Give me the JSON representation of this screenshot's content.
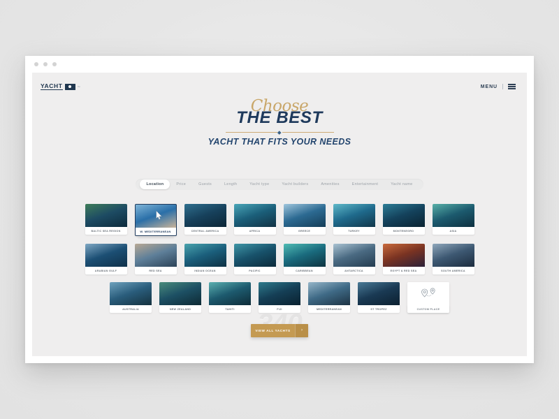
{
  "browser": {
    "dots": 3
  },
  "header": {
    "logo_word": "YACHT",
    "logo_tm": "™",
    "menu_label": "MENU"
  },
  "hero": {
    "script_word": "Choose",
    "main_line": "THE BEST",
    "sub_line": "YACHT THAT FITS YOUR NEEDS"
  },
  "filters": {
    "items": [
      {
        "label": "Location",
        "active": true
      },
      {
        "label": "Price",
        "active": false
      },
      {
        "label": "Guests",
        "active": false
      },
      {
        "label": "Length",
        "active": false
      },
      {
        "label": "Yacht type",
        "active": false
      },
      {
        "label": "Yacht builders",
        "active": false
      },
      {
        "label": "Amenities",
        "active": false
      },
      {
        "label": "Entertainment",
        "active": false
      },
      {
        "label": "Yacht name",
        "active": false
      }
    ]
  },
  "destinations": {
    "row1": [
      {
        "label": "BALTIC SEA REGION",
        "c1": "#1d4b63",
        "c2": "#3f7d5a",
        "c3": "#0d2b3c"
      },
      {
        "label": "W. MEDITERRANEAN",
        "c1": "#2a6fa8",
        "c2": "#7fb5d8",
        "c3": "#c9b49a",
        "active": true
      },
      {
        "label": "CENTRAL AMERICA",
        "c1": "#17415c",
        "c2": "#2f6f8e",
        "c3": "#0c2636"
      },
      {
        "label": "AFRICA",
        "c1": "#1b5f7a",
        "c2": "#4aa6b8",
        "c3": "#123244"
      }
    ],
    "row2": [
      {
        "label": "GREECE",
        "c1": "#2c6a92",
        "c2": "#9fc6dd",
        "c3": "#153d57"
      },
      {
        "label": "TURKEY",
        "c1": "#1f6a8c",
        "c2": "#5fb9c9",
        "c3": "#11364a"
      },
      {
        "label": "MONTENEGRO",
        "c1": "#14425c",
        "c2": "#2d7d96",
        "c3": "#0a2331"
      },
      {
        "label": "ASIA",
        "c1": "#1c5a6e",
        "c2": "#58b0a8",
        "c3": "#0e3040"
      }
    ],
    "row3": [
      {
        "label": "ARABIAN GULF",
        "c1": "#1c4f74",
        "c2": "#7fa8c4",
        "c3": "#0f3049"
      },
      {
        "label": "RED SEA",
        "c1": "#5e7f99",
        "c2": "#b8a894",
        "c3": "#2c4358"
      },
      {
        "label": "INDIAN OCEAN",
        "c1": "#1b5f7c",
        "c2": "#49a3ad",
        "c3": "#0d3043"
      },
      {
        "label": "PACIFIC",
        "c1": "#18526b",
        "c2": "#3f96a6",
        "c3": "#0b2a3a"
      }
    ],
    "row4": [
      {
        "label": "CARIBBEAN",
        "c1": "#1a6b7e",
        "c2": "#4fbcb4",
        "c3": "#0d3340"
      },
      {
        "label": "ANTARCTICA",
        "c1": "#4a6a82",
        "c2": "#a9c2d2",
        "c3": "#243c50"
      },
      {
        "label": "EGYPT & RED SEA",
        "c1": "#7a3322",
        "c2": "#c96a3c",
        "c3": "#2b2038"
      },
      {
        "label": "SOUTH AMERICA",
        "c1": "#3d5872",
        "c2": "#8fa7bb",
        "c3": "#1c2c3e"
      }
    ],
    "row5": [
      {
        "label": "AUSTRALIA",
        "c1": "#2a5d7c",
        "c2": "#6fa2bd",
        "c3": "#15323f"
      },
      {
        "label": "NEW ZEALAND",
        "c1": "#1d5064",
        "c2": "#4a8c7c",
        "c3": "#0e2a34"
      },
      {
        "label": "TAHITI",
        "c1": "#1d5a6e",
        "c2": "#5bb0b0",
        "c3": "#0e2c38"
      },
      {
        "label": "FIJI",
        "c1": "#153f56",
        "c2": "#2e7b8c",
        "c3": "#0a2230"
      },
      {
        "label": "MEDITERRANEAN",
        "c1": "#3f6a86",
        "c2": "#96b6c9",
        "c3": "#1d3344"
      },
      {
        "label": "ST TROPEZ",
        "c1": "#1a3a54",
        "c2": "#4a7a96",
        "c3": "#0c2030"
      }
    ],
    "custom": {
      "label": "CUSTOM PLACE",
      "icon": "map-pins-route-icon"
    }
  },
  "cta": {
    "ghost_count": "340",
    "button_label": "VIEW ALL YACHTS",
    "arrow_glyph": "›"
  },
  "colors": {
    "navy": "#1f3a5c",
    "gold": "#c49a52",
    "page_bg": "#e6e6e6",
    "viewport_bg": "#efeeee"
  }
}
